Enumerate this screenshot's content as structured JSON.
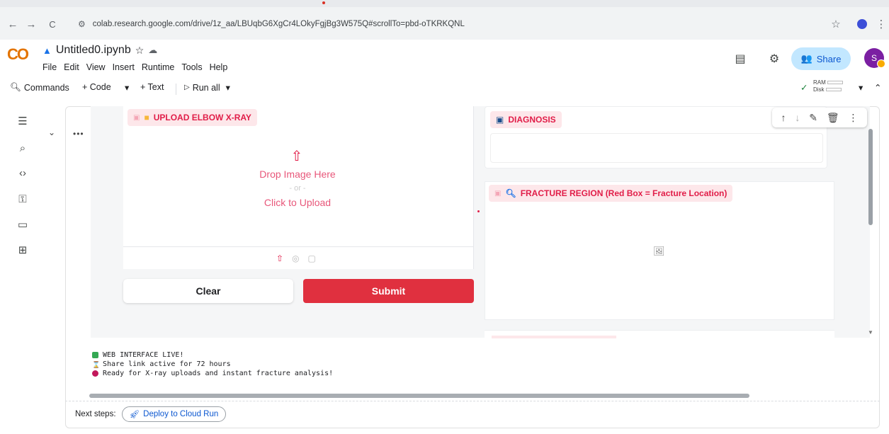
{
  "browser": {
    "back_icon": "←",
    "forward_icon": "→",
    "reload_icon": "C",
    "url": "colab.research.google.com/drive/1z_aa/LBUqbG6XgCr4LOkyFgjBg3W575Q#scrollTo=pbd-oTKRKQNL",
    "star_icon": "☆",
    "menu_icon": "⋮"
  },
  "colab": {
    "logo": "CO",
    "notebook_title": "Untitled0.ipynb",
    "star_icon": "☆",
    "cloud_icon": "☁",
    "menu": [
      "File",
      "Edit",
      "View",
      "Insert",
      "Runtime",
      "Tools",
      "Help"
    ],
    "share_label": "Share",
    "avatar_letter": "S"
  },
  "toolbar": {
    "commands": "Commands",
    "code": "+ Code",
    "text": "+ Text",
    "run_all": "Run all",
    "ram_label": "RAM",
    "disk_label": "Disk",
    "check_icon": "✓"
  },
  "gradio": {
    "upload_label": "UPLOAD ELBOW X-RAY",
    "drop_text": "Drop Image Here",
    "or_text": "- or -",
    "click_text": "Click to Upload",
    "clear_label": "Clear",
    "submit_label": "Submit",
    "diagnosis_label": "DIAGNOSIS",
    "fracture_label": "FRACTURE REGION (Red Box = Fracture Location)"
  },
  "output": {
    "line1": "WEB INTERFACE LIVE!",
    "line2": "Share link active for 72 hours",
    "line3": "Ready for X-ray uploads and instant fracture analysis!"
  },
  "next_steps": {
    "label": "Next steps:",
    "chip": "Deploy to Cloud Run"
  },
  "colors": {
    "accent_red": "#e0303f",
    "label_bg": "#fde7ea",
    "share_bg": "#c2e7ff"
  }
}
